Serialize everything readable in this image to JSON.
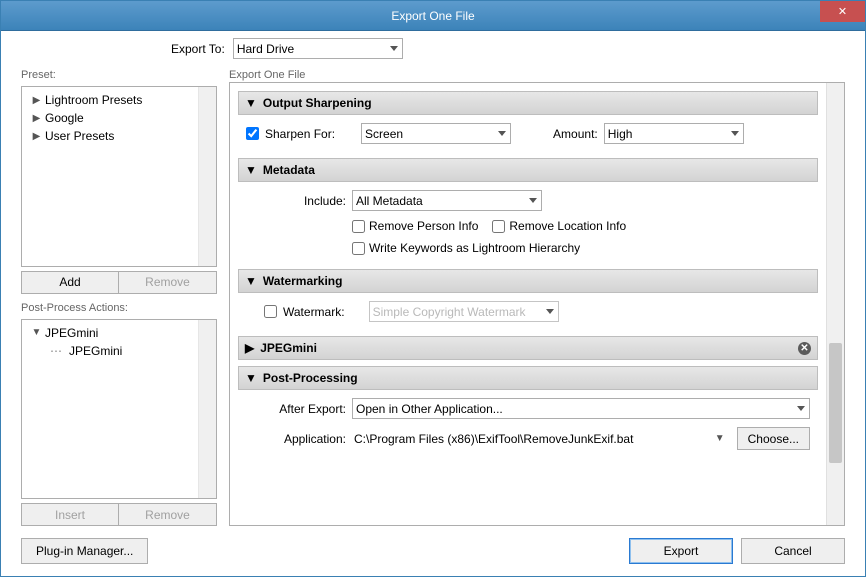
{
  "window": {
    "title": "Export One File"
  },
  "exportTo": {
    "label": "Export To:",
    "value": "Hard Drive"
  },
  "leftPanel": {
    "presetLabel": "Preset:",
    "presets": [
      "Lightroom Presets",
      "Google",
      "User Presets"
    ],
    "addBtn": "Add",
    "removeBtn": "Remove",
    "postProcessLabel": "Post-Process Actions:",
    "ppGroup": "JPEGmini",
    "ppItem": "JPEGmini",
    "insertBtn": "Insert",
    "removeBtn2": "Remove"
  },
  "rightPanel": {
    "heading": "Export One File",
    "sections": {
      "outputSharpening": {
        "title": "Output Sharpening",
        "sharpenForLabel": "Sharpen For:",
        "sharpenForValue": "Screen",
        "amountLabel": "Amount:",
        "amountValue": "High"
      },
      "metadata": {
        "title": "Metadata",
        "includeLabel": "Include:",
        "includeValue": "All Metadata",
        "removePerson": "Remove Person Info",
        "removeLocation": "Remove Location Info",
        "writeKeywords": "Write Keywords as Lightroom Hierarchy"
      },
      "watermarking": {
        "title": "Watermarking",
        "watermarkLabel": "Watermark:",
        "watermarkValue": "Simple Copyright Watermark"
      },
      "jpegmini": {
        "title": "JPEGmini"
      },
      "postProcessing": {
        "title": "Post-Processing",
        "afterExportLabel": "After Export:",
        "afterExportValue": "Open in Other Application...",
        "applicationLabel": "Application:",
        "applicationValue": "C:\\Program Files (x86)\\ExifTool\\RemoveJunkExif.bat",
        "chooseBtn": "Choose..."
      }
    }
  },
  "footer": {
    "pluginManager": "Plug-in Manager...",
    "export": "Export",
    "cancel": "Cancel"
  }
}
